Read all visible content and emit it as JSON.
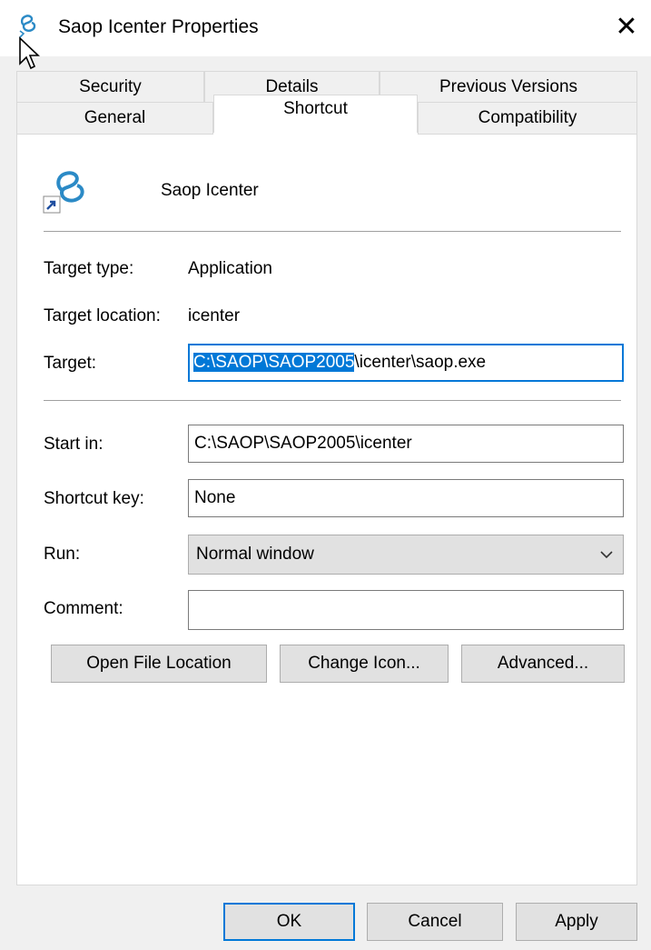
{
  "window": {
    "title": "Saop Icenter Properties",
    "close_glyph": "✕"
  },
  "tabs_row1": [
    "Security",
    "Details",
    "Previous Versions"
  ],
  "tabs_row2": [
    "General",
    "Shortcut",
    "Compatibility"
  ],
  "active_tab": "Shortcut",
  "shortcut": {
    "name": "Saop Icenter",
    "target_type_label": "Target type:",
    "target_type_value": "Application",
    "target_location_label": "Target location:",
    "target_location_value": "icenter",
    "target_label": "Target:",
    "target_selected": "C:\\SAOP\\SAOP2005",
    "target_rest": "\\icenter\\saop.exe",
    "start_in_label": "Start in:",
    "start_in_value": "C:\\SAOP\\SAOP2005\\icenter",
    "shortcut_key_label": "Shortcut key:",
    "shortcut_key_value": "None",
    "run_label": "Run:",
    "run_value": "Normal window",
    "comment_label": "Comment:",
    "comment_value": ""
  },
  "buttons": {
    "open_file_location": "Open File Location",
    "change_icon": "Change Icon...",
    "advanced": "Advanced...",
    "ok": "OK",
    "cancel": "Cancel",
    "apply": "Apply"
  },
  "icons": {
    "app": "saop-app-icon",
    "shortcut_overlay": "shortcut-arrow-icon",
    "dropdown": "chevron-down-icon"
  },
  "colors": {
    "accent": "#0078d7",
    "icon": "#2b8ac6"
  }
}
